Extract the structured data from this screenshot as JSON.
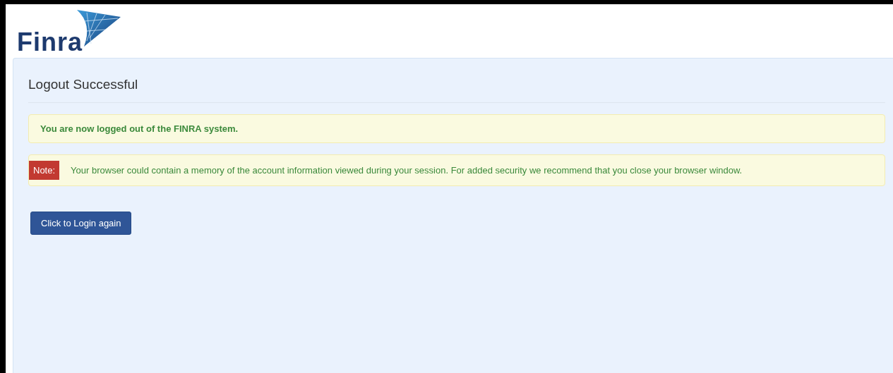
{
  "logo": {
    "text": "Finra"
  },
  "panel": {
    "title": "Logout Successful"
  },
  "alerts": [
    {
      "kind": "success",
      "text": "You are now logged out of the FINRA system."
    },
    {
      "kind": "note",
      "label": "Note:",
      "text": "Your browser could contain a memory of the account information viewed during your session. For added security we recommend that you close your browser window."
    }
  ],
  "buttons": [
    {
      "label": "Click to Login again"
    }
  ]
}
